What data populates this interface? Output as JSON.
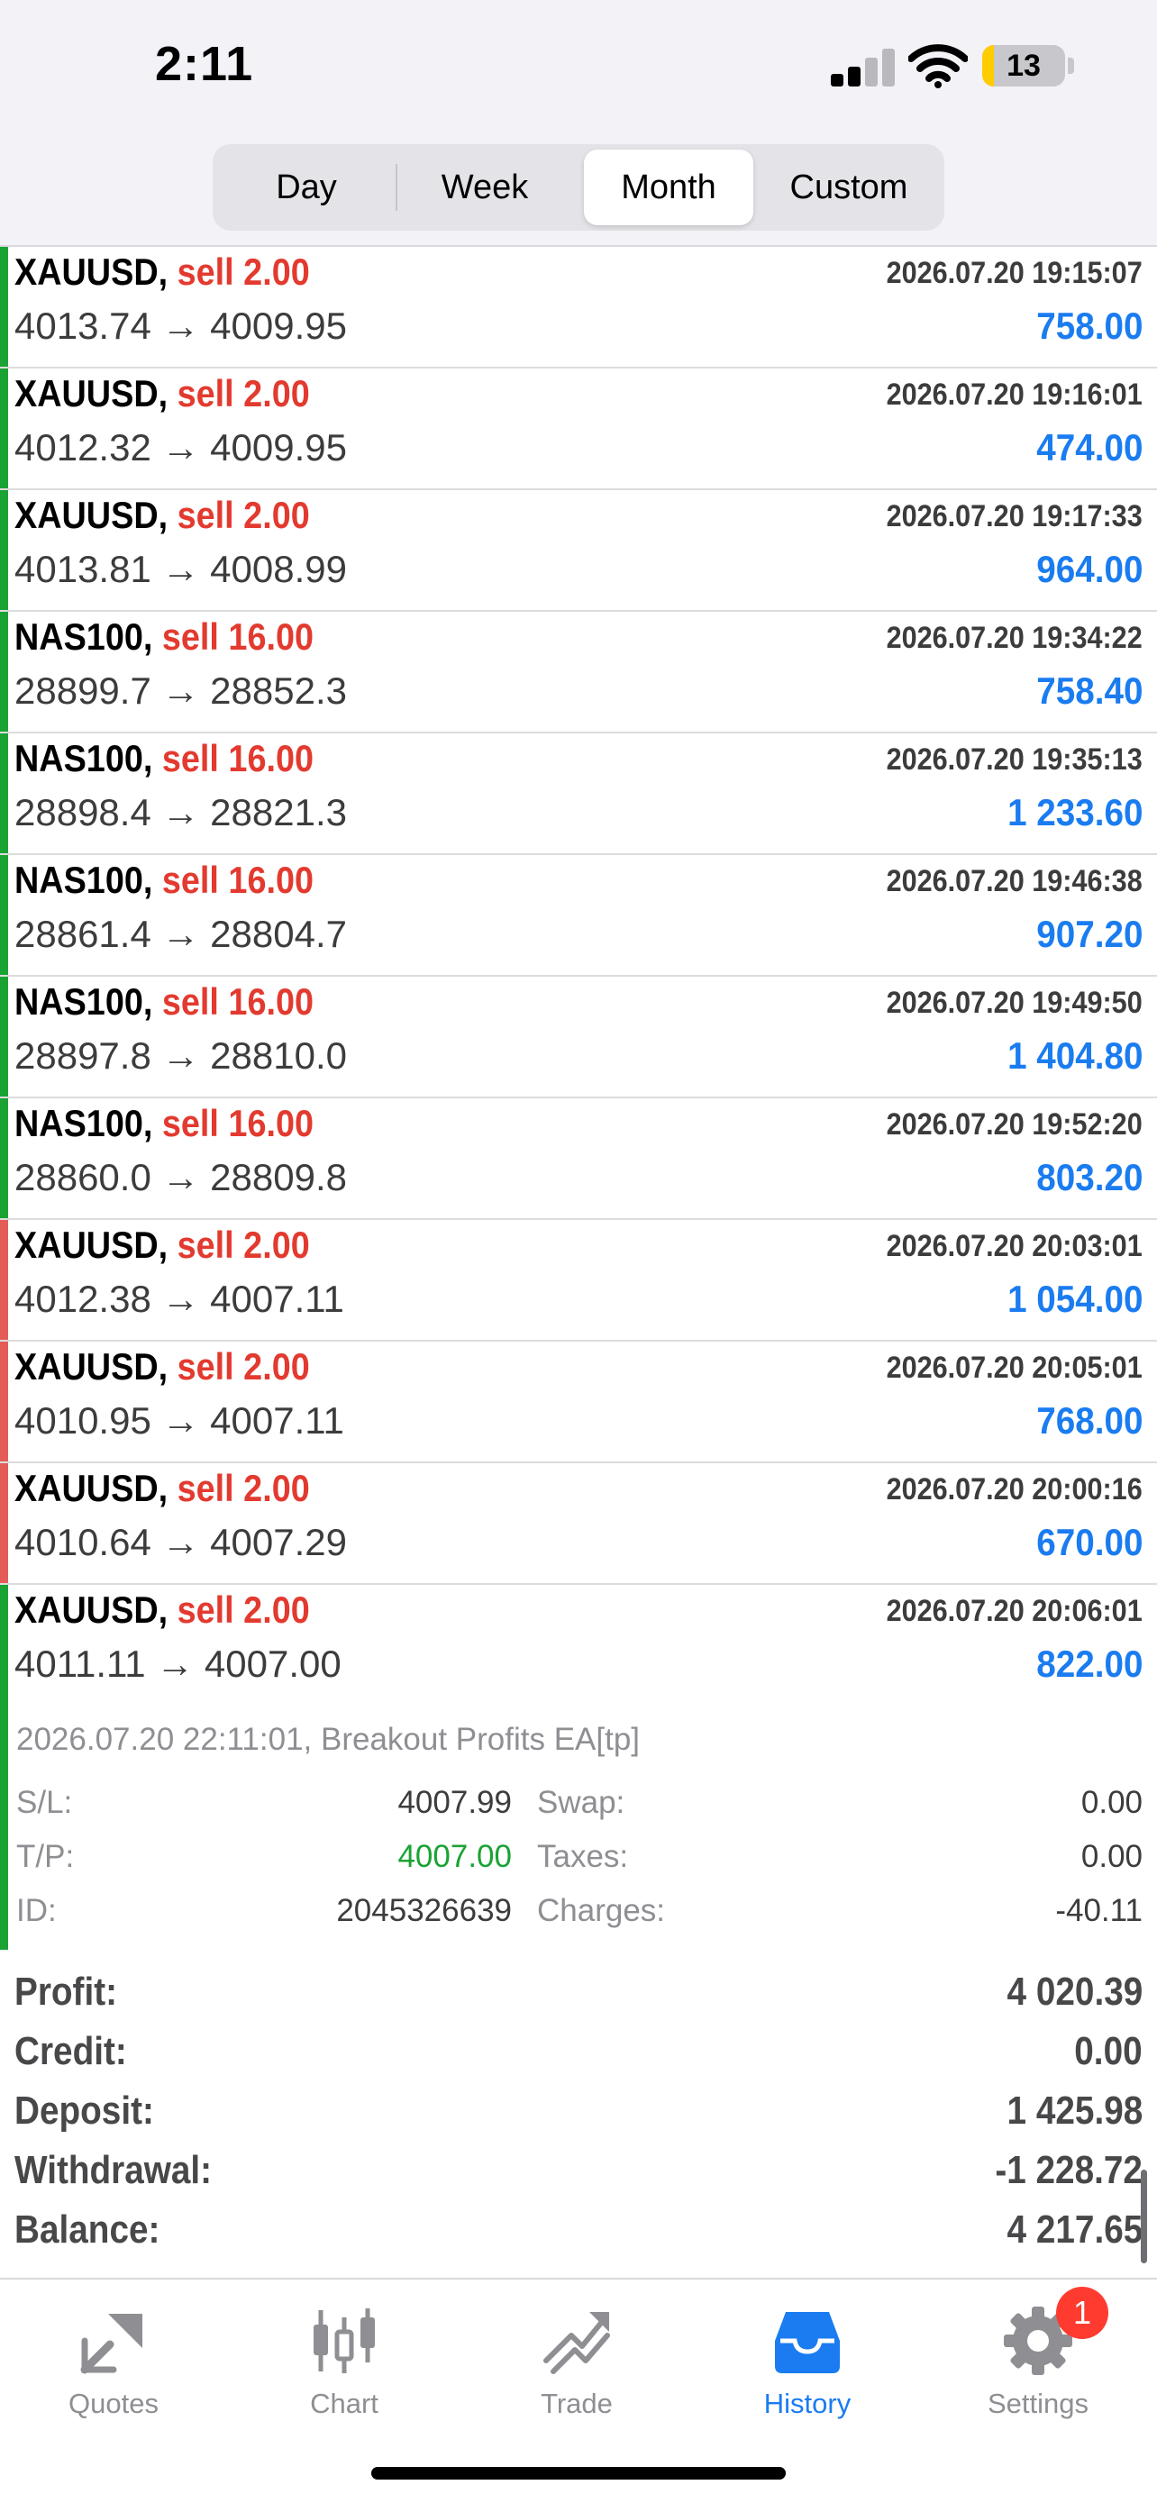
{
  "status_bar": {
    "time": "2:11",
    "battery": "13"
  },
  "period_tabs": [
    {
      "label": "Day",
      "active": false
    },
    {
      "label": "Week",
      "active": false
    },
    {
      "label": "Month",
      "active": true
    },
    {
      "label": "Custom",
      "active": false
    }
  ],
  "deals": [
    {
      "symbol": "XAUUSD,",
      "action": "sell 2.00",
      "time": "2026.07.20 19:15:07",
      "prices": "4013.74 → 4009.95",
      "profit": "758.00",
      "bar": "#1aa333"
    },
    {
      "symbol": "XAUUSD,",
      "action": "sell 2.00",
      "time": "2026.07.20 19:16:01",
      "prices": "4012.32 → 4009.95",
      "profit": "474.00",
      "bar": "#1aa333"
    },
    {
      "symbol": "XAUUSD,",
      "action": "sell 2.00",
      "time": "2026.07.20 19:17:33",
      "prices": "4013.81 → 4008.99",
      "profit": "964.00",
      "bar": "#1aa333"
    },
    {
      "symbol": "NAS100,",
      "action": "sell 16.00",
      "time": "2026.07.20 19:34:22",
      "prices": "28899.7 → 28852.3",
      "profit": "758.40",
      "bar": "#1aa333"
    },
    {
      "symbol": "NAS100,",
      "action": "sell 16.00",
      "time": "2026.07.20 19:35:13",
      "prices": "28898.4 → 28821.3",
      "profit": "1 233.60",
      "bar": "#1aa333"
    },
    {
      "symbol": "NAS100,",
      "action": "sell 16.00",
      "time": "2026.07.20 19:46:38",
      "prices": "28861.4 → 28804.7",
      "profit": "907.20",
      "bar": "#1aa333"
    },
    {
      "symbol": "NAS100,",
      "action": "sell 16.00",
      "time": "2026.07.20 19:49:50",
      "prices": "28897.8 → 28810.0",
      "profit": "1 404.80",
      "bar": "#1aa333"
    },
    {
      "symbol": "NAS100,",
      "action": "sell 16.00",
      "time": "2026.07.20 19:52:20",
      "prices": "28860.0 → 28809.8",
      "profit": "803.20",
      "bar": "#1aa333"
    },
    {
      "symbol": "XAUUSD,",
      "action": "sell 2.00",
      "time": "2026.07.20 20:03:01",
      "prices": "4012.38 → 4007.11",
      "profit": "1 054.00",
      "bar": "#e35d56"
    },
    {
      "symbol": "XAUUSD,",
      "action": "sell 2.00",
      "time": "2026.07.20 20:05:01",
      "prices": "4010.95 → 4007.11",
      "profit": "768.00",
      "bar": "#e35d56"
    },
    {
      "symbol": "XAUUSD,",
      "action": "sell 2.00",
      "time": "2026.07.20 20:00:16",
      "prices": "4010.64 → 4007.29",
      "profit": "670.00",
      "bar": "#e35d56"
    }
  ],
  "expanded_deal": {
    "symbol": "XAUUSD,",
    "action": "sell 2.00",
    "time": "2026.07.20 20:06:01",
    "prices": "4011.11 → 4007.00",
    "profit": "822.00",
    "bar": "#1aa333",
    "detail": "2026.07.20 22:11:01, Breakout Profits EA[tp]",
    "sl_label": "S/L:",
    "sl": "4007.99",
    "tp_label": "T/P:",
    "tp": "4007.00",
    "id_label": "ID:",
    "id": "2045326639",
    "swap_label": "Swap:",
    "swap": "0.00",
    "taxes_label": "Taxes:",
    "taxes": "0.00",
    "charges_label": "Charges:",
    "charges": "-40.11"
  },
  "summary": [
    {
      "label": "Profit:",
      "value": "4 020.39"
    },
    {
      "label": "Credit:",
      "value": "0.00"
    },
    {
      "label": "Deposit:",
      "value": "1 425.98"
    },
    {
      "label": "Withdrawal:",
      "value": "-1 228.72"
    },
    {
      "label": "Balance:",
      "value": "4 217.65"
    }
  ],
  "tabs": [
    {
      "label": "Quotes",
      "icon": "quotes-icon",
      "active": false
    },
    {
      "label": "Chart",
      "icon": "chart-icon",
      "active": false
    },
    {
      "label": "Trade",
      "icon": "trade-icon",
      "active": false
    },
    {
      "label": "History",
      "icon": "history-icon",
      "active": true
    },
    {
      "label": "Settings",
      "icon": "settings-icon",
      "active": false
    }
  ],
  "settings_badge": "1",
  "colors": {
    "accent": "#1a7cf0",
    "sell": "#e33a2f",
    "profit_bar": "#1aa333",
    "loss_bar": "#e35d56"
  }
}
